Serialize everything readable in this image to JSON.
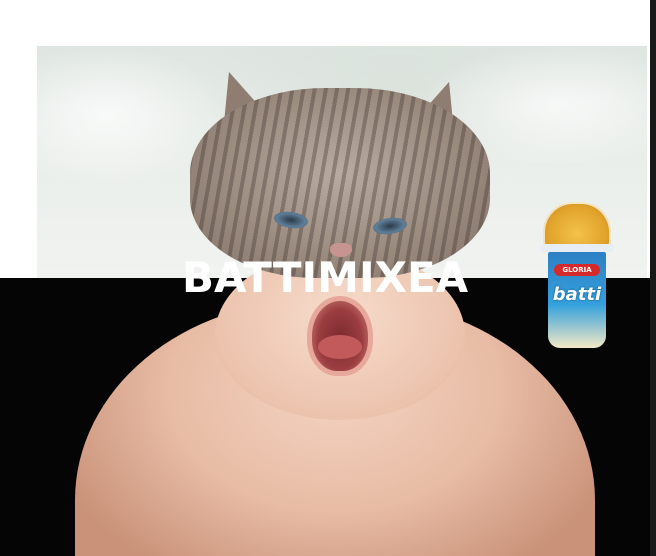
{
  "caption": "BATTIMIXEA",
  "product": {
    "brand_label": "GLORIA",
    "name_label": "batti"
  }
}
